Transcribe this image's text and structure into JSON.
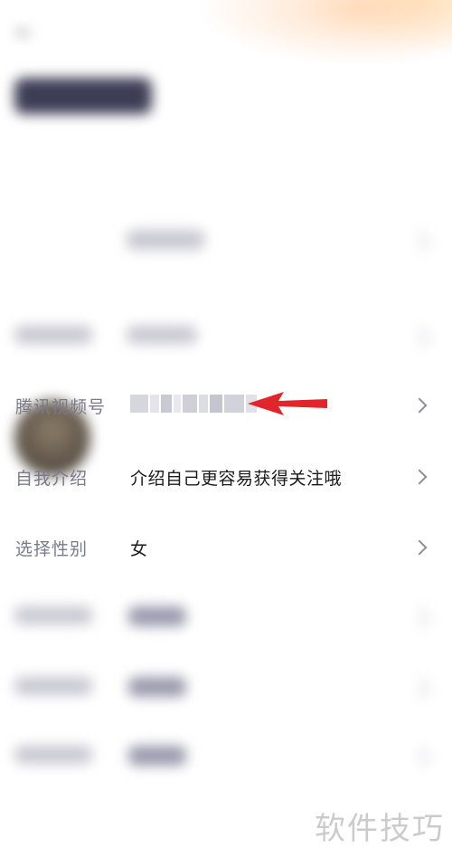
{
  "rows": {
    "tencent_video_id": {
      "label": "腾讯视频号"
    },
    "self_intro": {
      "label": "自我介绍",
      "value": "介绍自己更容易获得关注哦"
    },
    "gender": {
      "label": "选择性别",
      "value": "女"
    }
  },
  "colors": {
    "arrow": "#e0262b",
    "label": "#7a7a8a",
    "value": "#1a1a1a",
    "chevron": "#8e8e9c"
  },
  "watermark": "软件技巧"
}
